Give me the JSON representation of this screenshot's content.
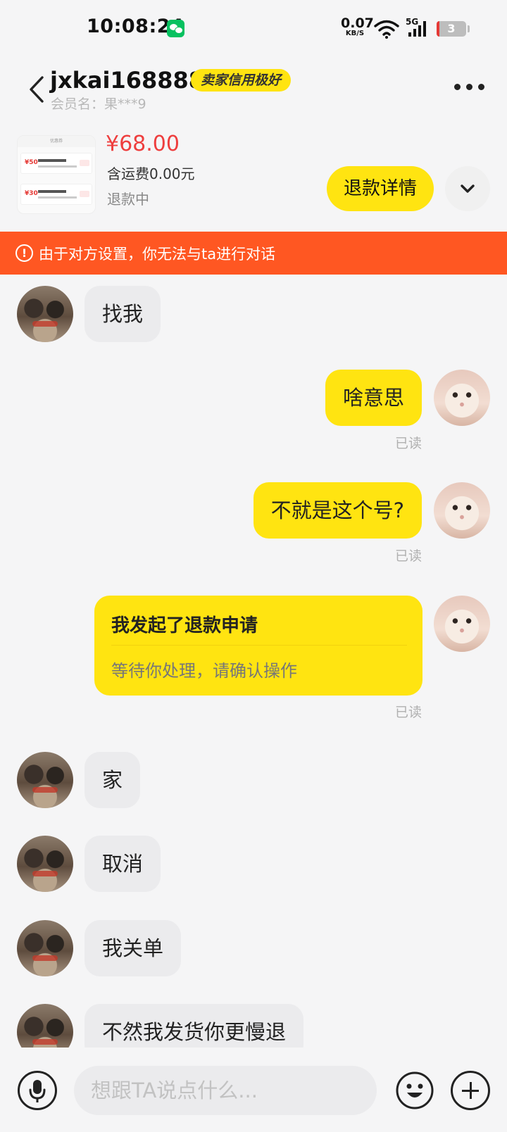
{
  "status_bar": {
    "time": "10:08:24",
    "net_speed": "0.07",
    "net_unit": "KB/S",
    "network": "5G",
    "battery": "3",
    "icons": [
      "wechat-icon",
      "wifi-icon",
      "signal-icon",
      "battery-icon"
    ]
  },
  "header": {
    "name": "jxkai168888",
    "badge": "卖家信用极好",
    "member": "会员名：果***9"
  },
  "product": {
    "price": "¥68.00",
    "shipping": "含运费0.00元",
    "status": "退款中",
    "refund_button": "退款详情",
    "thumb_title": "优惠券",
    "thumb_prices": [
      "¥50",
      "¥30"
    ]
  },
  "banner": {
    "icon": "!",
    "text": "由于对方设置，你无法与ta进行对话"
  },
  "messages": [
    {
      "side": "in",
      "text": "找我"
    },
    {
      "side": "out",
      "text": "啥意思",
      "read": "已读"
    },
    {
      "side": "out",
      "text": "不就是这个号?",
      "read": "已读"
    },
    {
      "side": "out",
      "type": "card",
      "title": "我发起了退款申请",
      "subtitle": "等待你处理，请确认操作",
      "read": "已读"
    },
    {
      "side": "in",
      "text": "家"
    },
    {
      "side": "in",
      "text": "取消"
    },
    {
      "side": "in",
      "text": "我关单"
    },
    {
      "side": "in",
      "text": "不然我发货你更慢退"
    }
  ],
  "input": {
    "placeholder": "想跟TA说点什么..."
  },
  "colors": {
    "accent_yellow": "#ffe411",
    "banner_orange": "#ff5722",
    "price_red": "#ee3e3e"
  }
}
